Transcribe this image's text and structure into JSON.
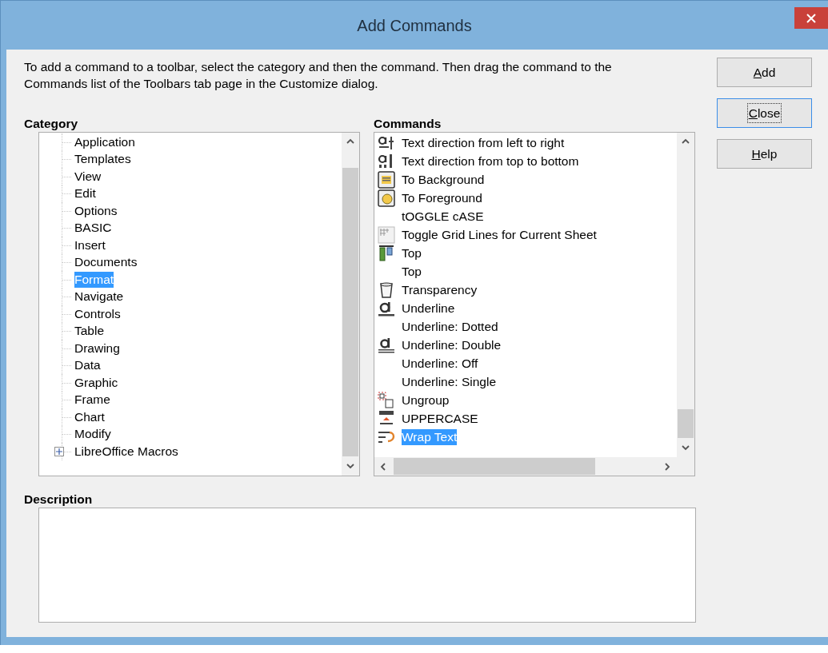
{
  "window": {
    "title": "Add Commands"
  },
  "intro": "To add a command to a toolbar, select the category and then the command. Then drag the command to the Commands list of the Toolbars tab page in the Customize dialog.",
  "category": {
    "label": "Category",
    "items": [
      {
        "label": "Application",
        "kind": "leaf",
        "selected": false
      },
      {
        "label": "Templates",
        "kind": "leaf",
        "selected": false
      },
      {
        "label": "View",
        "kind": "leaf",
        "selected": false
      },
      {
        "label": "Edit",
        "kind": "leaf",
        "selected": false
      },
      {
        "label": "Options",
        "kind": "leaf",
        "selected": false
      },
      {
        "label": "BASIC",
        "kind": "leaf",
        "selected": false
      },
      {
        "label": "Insert",
        "kind": "leaf",
        "selected": false
      },
      {
        "label": "Documents",
        "kind": "leaf",
        "selected": false
      },
      {
        "label": "Format",
        "kind": "leaf",
        "selected": true
      },
      {
        "label": "Navigate",
        "kind": "leaf",
        "selected": false
      },
      {
        "label": "Controls",
        "kind": "leaf",
        "selected": false
      },
      {
        "label": "Table",
        "kind": "leaf",
        "selected": false
      },
      {
        "label": "Drawing",
        "kind": "leaf",
        "selected": false
      },
      {
        "label": "Data",
        "kind": "leaf",
        "selected": false
      },
      {
        "label": "Graphic",
        "kind": "leaf",
        "selected": false
      },
      {
        "label": "Frame",
        "kind": "leaf",
        "selected": false
      },
      {
        "label": "Chart",
        "kind": "leaf",
        "selected": false
      },
      {
        "label": "Modify",
        "kind": "leaf",
        "selected": false
      },
      {
        "label": "LibreOffice Macros",
        "kind": "group",
        "expanded": false,
        "selected": false
      }
    ]
  },
  "commands": {
    "label": "Commands",
    "items": [
      {
        "label": "Text direction from left to right",
        "kind": "text-lr",
        "selected": false
      },
      {
        "label": "Text direction from top to bottom",
        "kind": "text-tb",
        "selected": false
      },
      {
        "label": "To Background",
        "kind": "to-back",
        "selected": false
      },
      {
        "label": "To Foreground",
        "kind": "to-front",
        "selected": false
      },
      {
        "label": "tOGGLE cASE",
        "selected": false
      },
      {
        "label": "Toggle Grid Lines for Current Sheet",
        "kind": "grid",
        "selected": false
      },
      {
        "label": "Top",
        "kind": "align-top",
        "selected": false
      },
      {
        "label": "Top",
        "selected": false
      },
      {
        "label": "Transparency",
        "kind": "transparency",
        "selected": false
      },
      {
        "label": "Underline",
        "kind": "underline",
        "selected": false
      },
      {
        "label": "Underline: Dotted",
        "selected": false
      },
      {
        "label": "Underline: Double",
        "kind": "underline-double",
        "selected": false
      },
      {
        "label": "Underline: Off",
        "selected": false
      },
      {
        "label": "Underline: Single",
        "selected": false
      },
      {
        "label": "Ungroup",
        "kind": "ungroup",
        "selected": false
      },
      {
        "label": "UPPERCASE",
        "kind": "uppercase",
        "selected": false
      },
      {
        "label": "Wrap Text",
        "kind": "wrap",
        "selected": true
      }
    ]
  },
  "description": {
    "label": "Description"
  },
  "buttons": [
    {
      "label": "Add",
      "focused": false
    },
    {
      "label": "Close",
      "focused": true
    },
    {
      "label": "Help",
      "focused": false
    }
  ]
}
